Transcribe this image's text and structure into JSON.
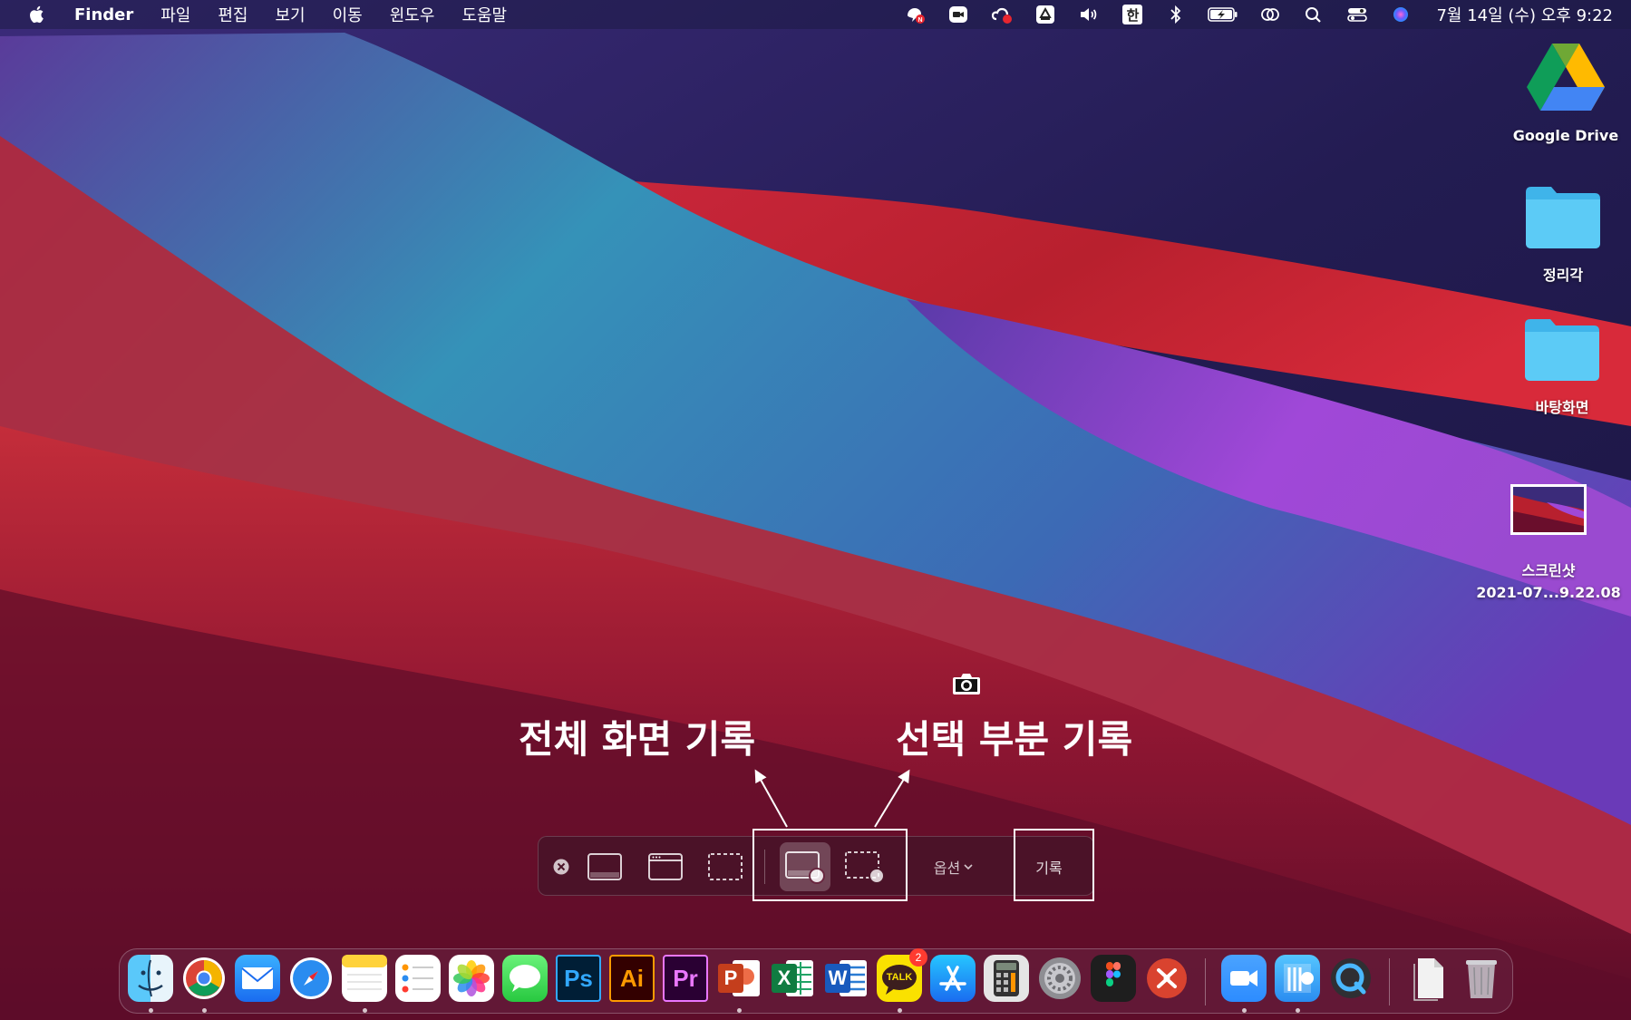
{
  "menubar": {
    "apple_icon": "apple-logo-icon",
    "app_name": "Finder",
    "menus": [
      "파일",
      "편집",
      "보기",
      "이동",
      "윈도우",
      "도움말"
    ],
    "status_icons": [
      "naver-whale-icon",
      "zoom-icon",
      "creative-cloud-icon",
      "google-drive-icon",
      "volume-icon",
      "input-source-icon",
      "bluetooth-icon",
      "battery-charging-icon",
      "screen-mirroring-icon",
      "search-icon",
      "control-center-icon",
      "siri-icon"
    ],
    "input_source": "한",
    "clock": "7월 14일 (수) 오후 9:22"
  },
  "desktop": {
    "items": [
      {
        "label": "Google Drive",
        "icon": "google-drive-icon"
      },
      {
        "label": "정리각",
        "icon": "folder-icon"
      },
      {
        "label": "바탕화면",
        "icon": "folder-icon"
      },
      {
        "label": "스크린샷",
        "label2": "2021-07...9.22.08",
        "icon": "screenshot-thumbnail-icon"
      }
    ]
  },
  "annotations": {
    "full_screen_record": "전체 화면 기록",
    "selection_record": "선택 부분 기록"
  },
  "toolbar": {
    "close_icon": "close-icon",
    "capture_entire_screen": "capture-entire-screen-icon",
    "capture_window": "capture-window-icon",
    "capture_selection": "capture-selection-icon",
    "record_entire_screen": "record-entire-screen-icon",
    "record_selection": "record-selection-icon",
    "options_label": "옵션",
    "record_label": "기록"
  },
  "dock": {
    "apps": [
      {
        "name": "Finder",
        "icon": "finder-icon",
        "running": true
      },
      {
        "name": "Chrome",
        "icon": "chrome-icon",
        "running": true
      },
      {
        "name": "Mail",
        "icon": "mail-icon",
        "running": false
      },
      {
        "name": "Safari",
        "icon": "safari-icon",
        "running": false
      },
      {
        "name": "Notes",
        "icon": "notes-icon",
        "running": true
      },
      {
        "name": "Reminders",
        "icon": "reminders-icon",
        "running": false
      },
      {
        "name": "Photos",
        "icon": "photos-icon",
        "running": false
      },
      {
        "name": "Messages",
        "icon": "messages-icon",
        "running": false
      },
      {
        "name": "Photoshop",
        "icon": "photoshop-icon",
        "label": "Ps",
        "running": false
      },
      {
        "name": "Illustrator",
        "icon": "illustrator-icon",
        "label": "Ai",
        "running": false
      },
      {
        "name": "Premiere Pro",
        "icon": "premiere-icon",
        "label": "Pr",
        "running": false
      },
      {
        "name": "PowerPoint",
        "icon": "powerpoint-icon",
        "label": "P",
        "running": true
      },
      {
        "name": "Excel",
        "icon": "excel-icon",
        "label": "X",
        "running": false
      },
      {
        "name": "Word",
        "icon": "word-icon",
        "label": "W",
        "running": false
      },
      {
        "name": "KakaoTalk",
        "icon": "kakaotalk-icon",
        "label": "TALK",
        "badge": "2",
        "running": true
      },
      {
        "name": "App Store",
        "icon": "app-store-icon",
        "running": false
      },
      {
        "name": "Calculator",
        "icon": "calculator-icon",
        "running": false
      },
      {
        "name": "System Preferences",
        "icon": "system-preferences-icon",
        "running": false
      },
      {
        "name": "Figma",
        "icon": "figma-icon",
        "running": false
      },
      {
        "name": "Remote Desktop",
        "icon": "remote-desktop-icon",
        "running": false
      },
      {
        "name": "Zoom",
        "icon": "zoom-app-icon",
        "running": true
      },
      {
        "name": "Hancom",
        "icon": "hancom-icon",
        "running": true
      },
      {
        "name": "QuickTime",
        "icon": "quicktime-icon",
        "running": false
      },
      {
        "name": "Documents",
        "icon": "documents-stack-icon",
        "running": false
      },
      {
        "name": "Trash",
        "icon": "trash-icon",
        "running": false
      }
    ]
  }
}
